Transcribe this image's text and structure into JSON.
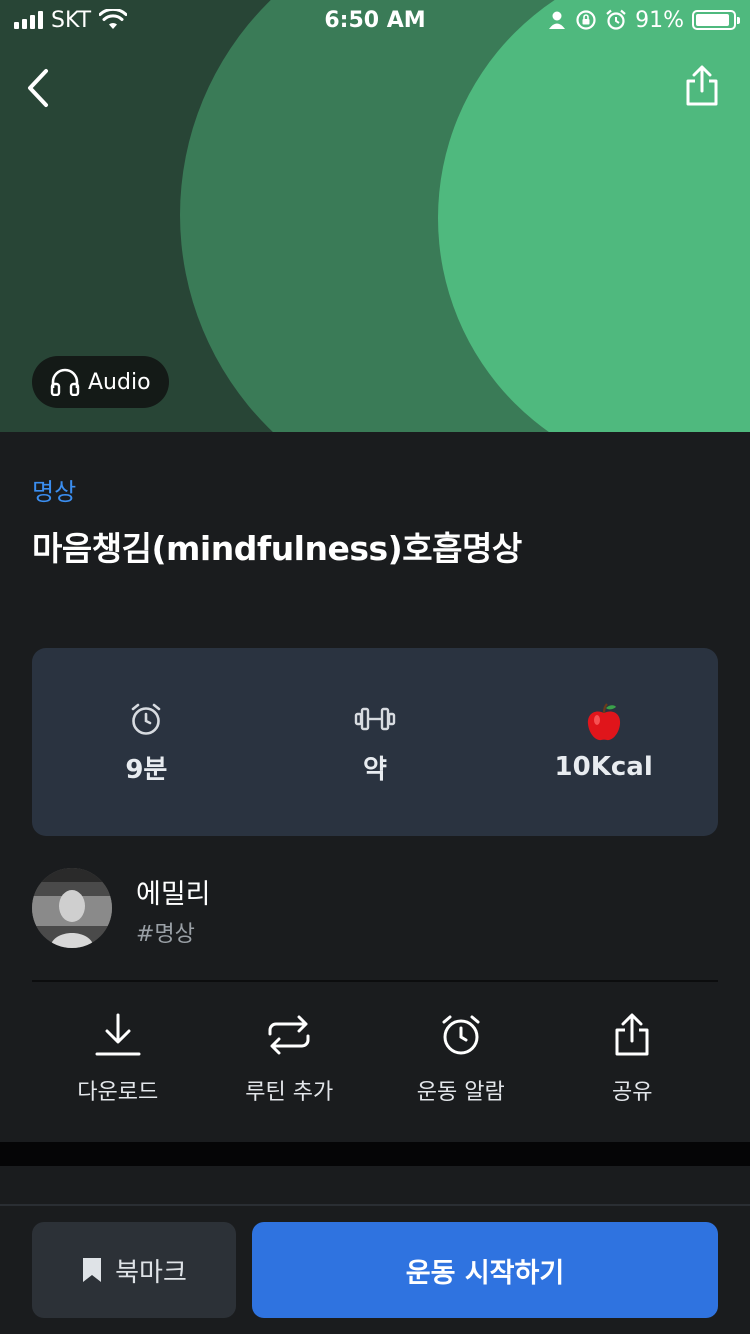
{
  "status_bar": {
    "carrier": "SKT",
    "time": "6:50 AM",
    "battery_percent": "91%",
    "battery_level": 0.91
  },
  "hero": {
    "audio_badge": "Audio",
    "colors": {
      "dark": "#2b4a3a",
      "mid": "#3f8c60",
      "light": "#52c688"
    }
  },
  "content": {
    "category": "명상",
    "title": "마음챙김(mindfulness)호흡명상"
  },
  "stats": {
    "duration": "9분",
    "intensity": "약",
    "calories": "10Kcal"
  },
  "instructor": {
    "name": "에밀리",
    "tag": "#명상"
  },
  "actions": {
    "download": "다운로드",
    "add_routine": "루틴 추가",
    "workout_alarm": "운동 알람",
    "share": "공유"
  },
  "bottom_bar": {
    "bookmark": "북마크",
    "start": "운동 시작하기"
  },
  "colors": {
    "accent": "#3b8ef0",
    "primary_button": "#2f73e0",
    "background": "#1a1c1e",
    "card": "#2a3340"
  }
}
